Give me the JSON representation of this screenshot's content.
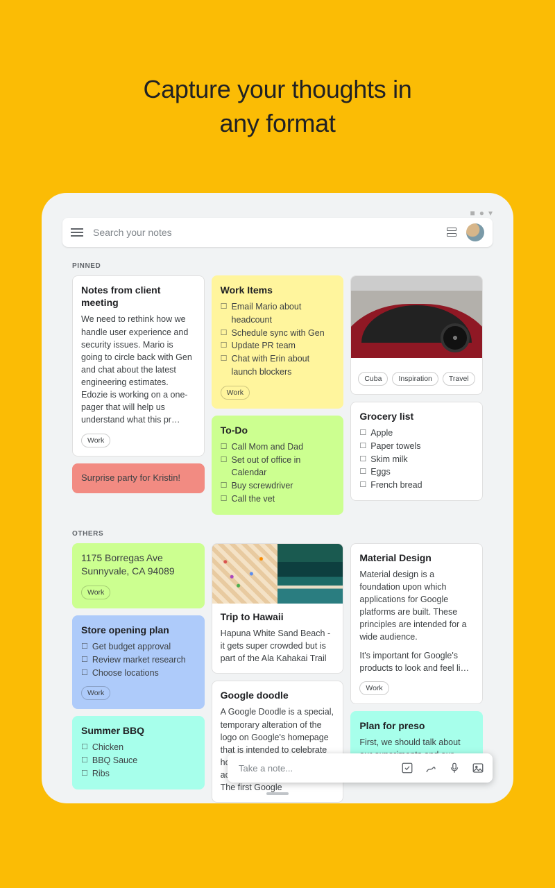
{
  "headline_l1": "Capture your thoughts in",
  "headline_l2": "any format",
  "search_placeholder": "Search your notes",
  "sections": {
    "pinned": "PINNED",
    "others": "OTHERS"
  },
  "takeNote": "Take a note...",
  "notes": {
    "client": {
      "title": "Notes from client meeting",
      "body": "We need to rethink how we handle user experience and security issues. Mario is going to circle back with Gen and chat about the latest engineering estimates. Edozie is working on a one-pager that will help us understand what this pr…",
      "tags": [
        "Work"
      ]
    },
    "surprise": {
      "title": "Surprise party for Kristin!"
    },
    "workItems": {
      "title": "Work Items",
      "items": [
        "Email Mario about headcount",
        "Schedule sync with Gen",
        "Update PR team",
        "Chat with Erin about launch blockers"
      ],
      "tags": [
        "Work"
      ]
    },
    "todo": {
      "title": "To-Do",
      "items": [
        "Call Mom and Dad",
        "Set out of office in Calendar",
        "Buy screwdriver",
        "Call the vet"
      ]
    },
    "carTags": [
      "Cuba",
      "Inspiration",
      "Travel"
    ],
    "grocery": {
      "title": "Grocery list",
      "items": [
        "Apple",
        "Paper towels",
        "Skim milk",
        "Eggs",
        "French bread"
      ]
    },
    "address": {
      "line1": "1175 Borregas Ave",
      "line2": "Sunnyvale, CA 94089",
      "tags": [
        "Work"
      ]
    },
    "store": {
      "title": "Store opening plan",
      "items": [
        "Get budget approval",
        "Review market research",
        "Choose locations"
      ],
      "tags": [
        "Work"
      ]
    },
    "bbq": {
      "title": "Summer BBQ",
      "items": [
        "Chicken",
        "BBQ Sauce",
        "Ribs"
      ]
    },
    "hawaii": {
      "title": "Trip to Hawaii",
      "body": "Hapuna White Sand Beach - it gets super crowded but is part of the Ala Kahakai Trail"
    },
    "doodle": {
      "title": "Google doodle",
      "body": "A Google Doodle is a special, temporary alteration of the logo on Google's homepage that is intended to celebrate holidays, events, achievements, and people. The first Google"
    },
    "material": {
      "title": "Material Design",
      "body1": "Material design is a foundation upon which applications for Google platforms are built. These principles are intended for a wide audience.",
      "body2": "It's important for Google's products to look and feel li…",
      "tags": [
        "Work"
      ]
    },
    "preso": {
      "title": "Plan for preso",
      "body": "First, we should talk about our experiments and our"
    }
  }
}
